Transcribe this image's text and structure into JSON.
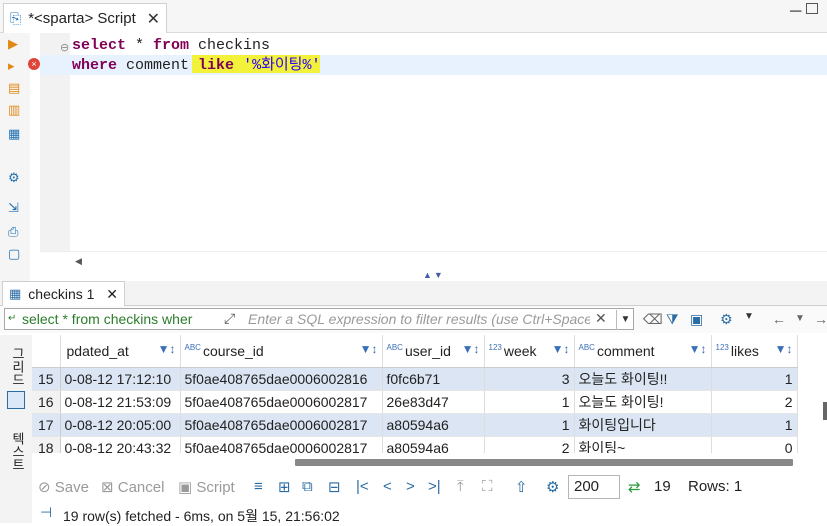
{
  "editor_tab": {
    "title": "*<sparta> Script"
  },
  "sql": {
    "line1": {
      "kw1": "select",
      "mid": " * ",
      "kw2": "from",
      "tail": " checkins"
    },
    "line2": {
      "kw1": "where",
      "mid": " comment ",
      "kw2": "like",
      "space": " ",
      "str": "'%화이팅%'"
    }
  },
  "results_tab": {
    "title": "checkins 1"
  },
  "filter": {
    "query": "select * from checkins wher",
    "placeholder": "Enter a SQL expression to filter results (use Ctrl+Space)"
  },
  "side_tabs": {
    "grid": "그리드",
    "text": "텍스트"
  },
  "grid": {
    "columns": [
      {
        "label": "pdated_at",
        "type": ""
      },
      {
        "label": "course_id",
        "type": "ABC"
      },
      {
        "label": "user_id",
        "type": "ABC"
      },
      {
        "label": "week",
        "type": "123"
      },
      {
        "label": "comment",
        "type": "ABC"
      },
      {
        "label": "likes",
        "type": "123"
      }
    ],
    "rows": [
      {
        "n": "15",
        "updated_at": "0-08-12 17:12:10",
        "course_id": "5f0ae408765dae0006002816",
        "user_id": "f0fc6b71",
        "week": "3",
        "comment": "오늘도 화이팅!!",
        "likes": "1",
        "selected": true
      },
      {
        "n": "16",
        "updated_at": "0-08-12 21:53:09",
        "course_id": "5f0ae408765dae0006002817",
        "user_id": "26e83d47",
        "week": "1",
        "comment": "오늘도 화이팅!",
        "likes": "2",
        "selected": false
      },
      {
        "n": "17",
        "updated_at": "0-08-12 20:05:00",
        "course_id": "5f0ae408765dae0006002817",
        "user_id": "a80594a6",
        "week": "1",
        "comment": "화이팅입니다",
        "likes": "1",
        "selected": true
      },
      {
        "n": "18",
        "updated_at": "0-08-12 20:43:32",
        "course_id": "5f0ae408765dae0006002817",
        "user_id": "a80594a6",
        "week": "2",
        "comment": "화이팅~",
        "likes": "0",
        "selected": false
      }
    ]
  },
  "toolbar": {
    "save": "Save",
    "cancel": "Cancel",
    "script": "Script",
    "fetch_size": "200",
    "refresh_count": "19",
    "rows_label": "Rows: 1"
  },
  "status": {
    "message": "19 row(s) fetched - 6ms, on 5월 15, 21:56:02"
  },
  "colors": {
    "selected_row": "#dbe5f3",
    "keyword": "#7f0055",
    "string": "#2a00ff",
    "highlight": "#f2f23a",
    "accent": "#2b6ca3"
  }
}
